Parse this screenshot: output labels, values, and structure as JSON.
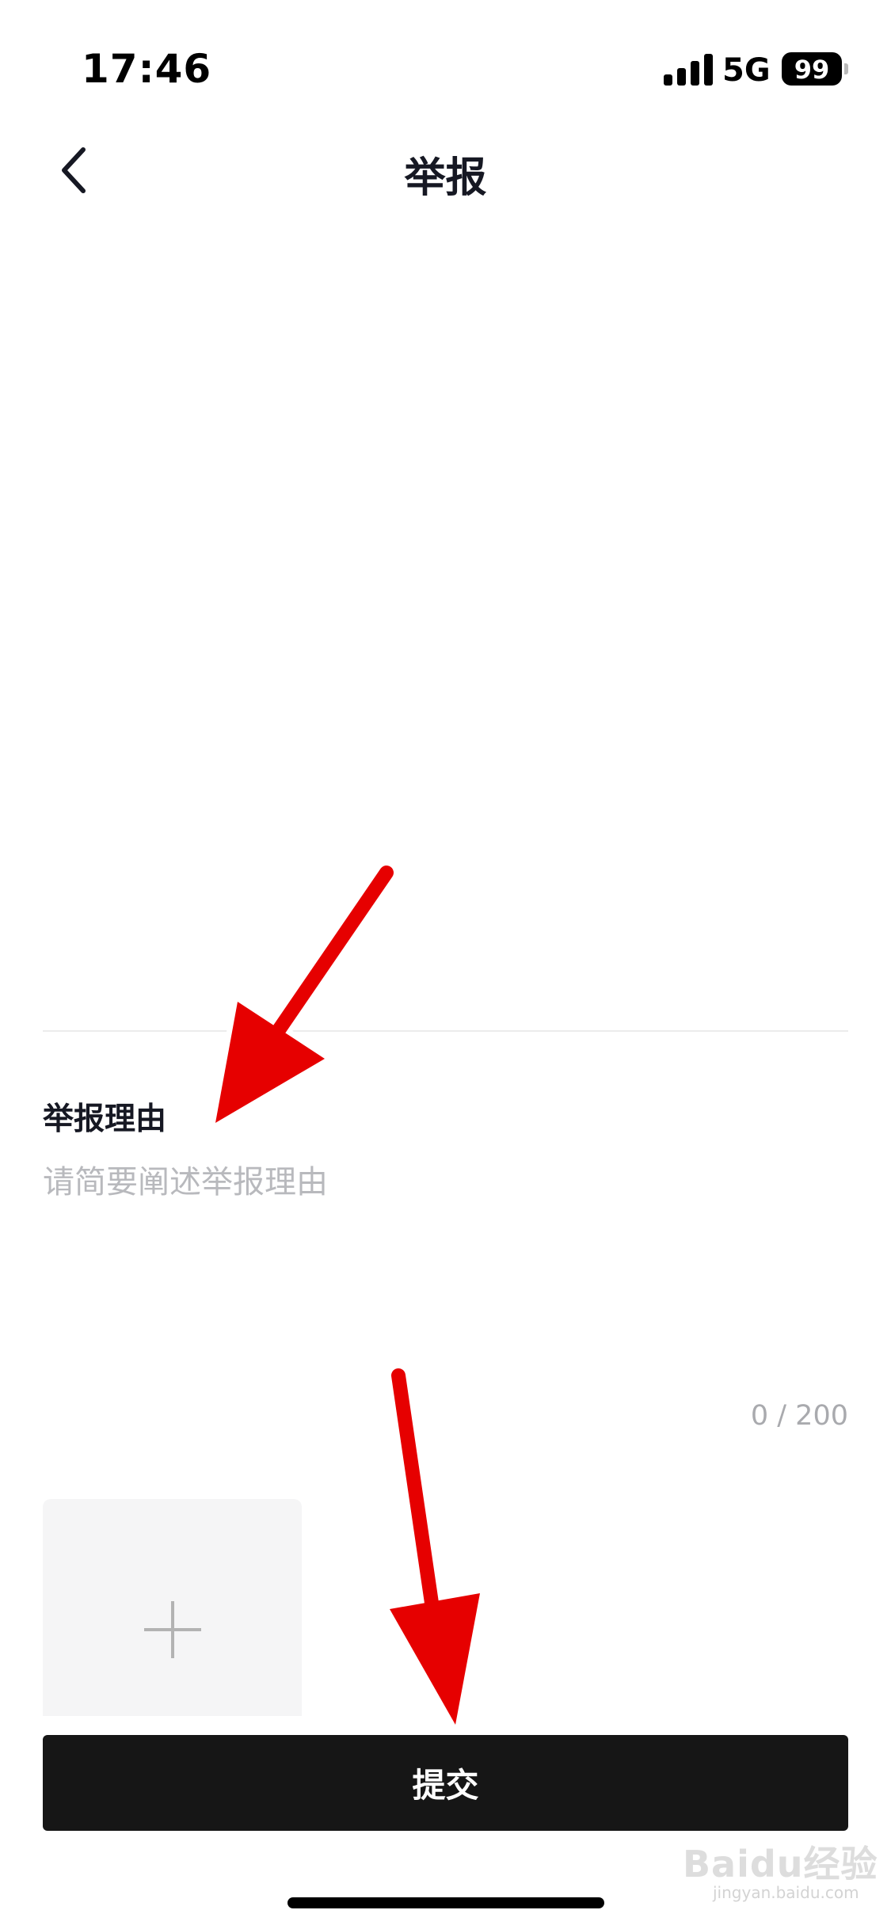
{
  "status_bar": {
    "time": "17:46",
    "network": "5G",
    "battery": "99"
  },
  "nav": {
    "back_icon": "chevron-left-icon",
    "title": "举报"
  },
  "form": {
    "reason_label": "举报理由",
    "reason_placeholder": "请简要阐述举报理由",
    "reason_value": "",
    "char_counter": "0 / 200",
    "upload_icon": "plus-icon"
  },
  "actions": {
    "submit_label": "提交"
  },
  "watermark": {
    "brand": "Baidu经验",
    "url": "jingyan.baidu.com"
  },
  "colors": {
    "annotation_arrow": "#e60000",
    "submit_background": "#161616",
    "placeholder": "#b8b9bd"
  }
}
